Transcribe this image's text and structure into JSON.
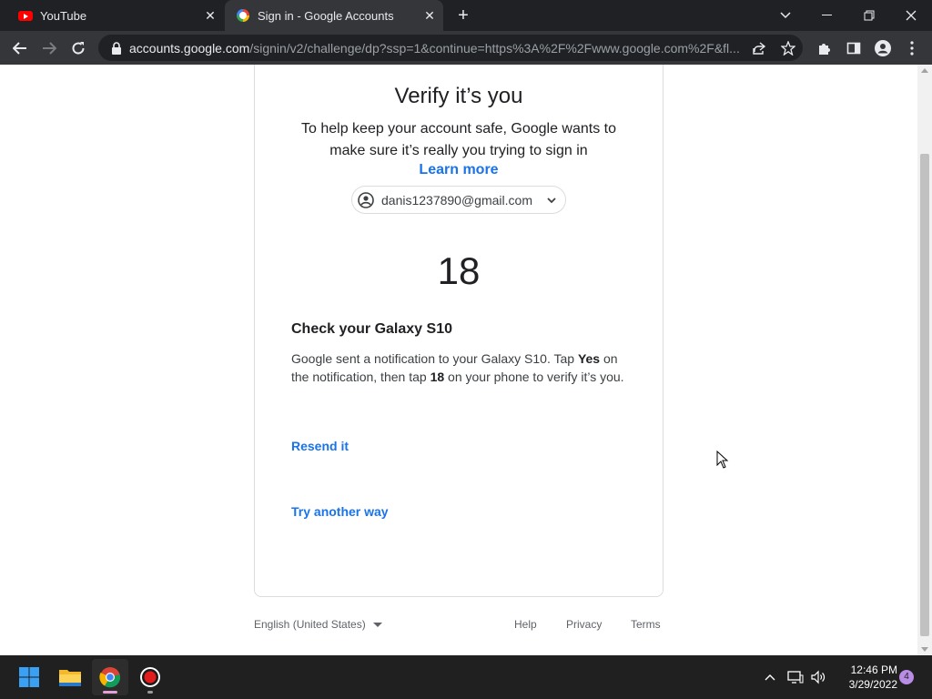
{
  "browser": {
    "tabs": [
      {
        "title": "YouTube",
        "favicon": "youtube-icon",
        "active": false
      },
      {
        "title": "Sign in - Google Accounts",
        "favicon": "google-icon",
        "active": true
      }
    ],
    "url_host": "accounts.google.com",
    "url_path": "/signin/v2/challenge/dp?ssp=1&continue=https%3A%2F%2Fwww.google.com%2F&fl..."
  },
  "page": {
    "heading": "Verify it’s you",
    "subtext": "To help keep your account safe, Google wants to make sure it’s really you trying to sign in",
    "learn_more": "Learn more",
    "account_email": "danis1237890@gmail.com",
    "verification_number": "18",
    "check_title": "Check your Galaxy S10",
    "desc_part1": "Google sent a notification to your Galaxy S10. Tap ",
    "desc_bold1": "Yes",
    "desc_part2": " on the notification, then tap ",
    "desc_bold2": "18",
    "desc_part3": " on your phone to verify it’s you.",
    "resend": "Resend it",
    "try_another": "Try another way"
  },
  "footer": {
    "language": "English (United States)",
    "help": "Help",
    "privacy": "Privacy",
    "terms": "Terms"
  },
  "taskbar": {
    "time": "12:46 PM",
    "date": "3/29/2022",
    "notification_count": "4"
  },
  "colors": {
    "link": "#1a73e8",
    "browser_frame": "#202124",
    "toolbar": "#35363a"
  }
}
